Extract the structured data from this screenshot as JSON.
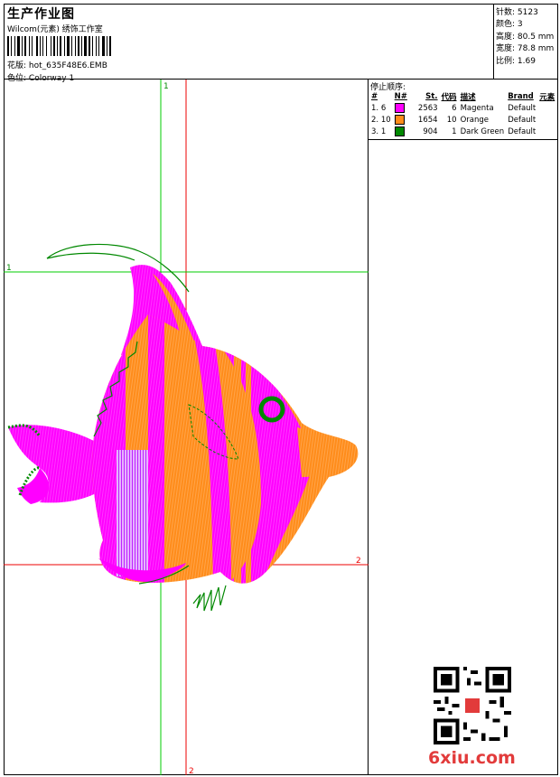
{
  "header": {
    "title": "生产作业图",
    "subtitle": "Wilcom(元素) 绣饰工作室",
    "pattern_label": "花版:",
    "pattern_value": "hot_635F48E6.EMB",
    "colorway_label": "色位:",
    "colorway_value": "Colorway 1"
  },
  "stats": {
    "stitches": "针数: 5123",
    "colors": "颜色: 3",
    "height": "高度: 80.5 mm",
    "width": "宽度: 78.8 mm",
    "scale": "比例: 1.69"
  },
  "stop_sequence": {
    "title": "停止顺序:",
    "headers": [
      "#",
      "N#",
      "St.",
      "代码",
      "描述",
      "Brand",
      "元素"
    ],
    "rows": [
      {
        "idx": "1.",
        "n": "6",
        "color": "#ff00ff",
        "stitches": "2563",
        "code": "6",
        "desc": "Magenta",
        "brand": "Default"
      },
      {
        "idx": "2.",
        "n": "10",
        "color": "#ff8c1a",
        "stitches": "1654",
        "code": "10",
        "desc": "Orange",
        "brand": "Default"
      },
      {
        "idx": "3.",
        "n": "1",
        "color": "#008800",
        "stitches": "904",
        "code": "1",
        "desc": "Dark Green",
        "brand": "Default"
      }
    ]
  },
  "guides": {
    "v1_label": "1",
    "h1_label": "1",
    "h2_label": "2",
    "v2_label": "2"
  },
  "colors": {
    "magenta": "#ff00ff",
    "orange": "#ff8c1a",
    "dark_green": "#008800",
    "guide_green": "#00cc00",
    "guide_red": "#ee0000",
    "light_purple": "#d48cff"
  },
  "watermark": {
    "brand": "6xiu.com"
  }
}
